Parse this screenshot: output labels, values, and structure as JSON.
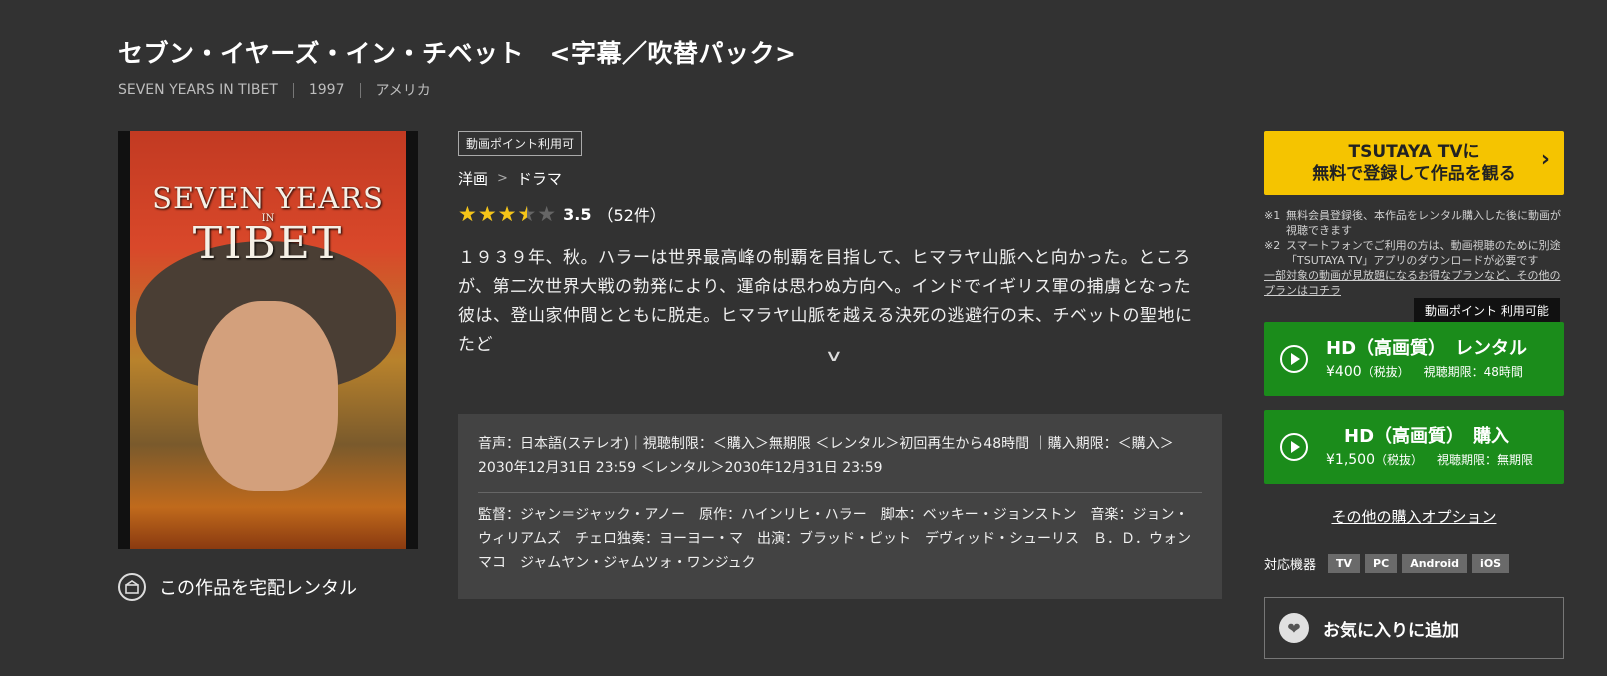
{
  "title": "セブン・イヤーズ・イン・チベット　<字幕／吹替パック>",
  "meta": {
    "original_title": "SEVEN YEARS IN TIBET",
    "year": "1997",
    "country": "アメリカ"
  },
  "poster": {
    "line1": "SEVEN YEARS",
    "line2": "IN",
    "line3": "TIBET"
  },
  "home_rental_label": "この作品を宅配レンタル",
  "point_badge": "動画ポイント利用可",
  "breadcrumb": [
    "洋画",
    "ドラマ"
  ],
  "rating": {
    "value": 3.5,
    "score_text": "3.5",
    "count_text": "（52件）"
  },
  "synopsis": "１９３９年、秋。ハラーは世界最高峰の制覇を目指して、ヒマラヤ山脈へと向かった。ところが、第二次世界大戦の勃発により、運命は思わぬ方向へ。インドでイギリス軍の捕虜となった彼は、登山家仲間とともに脱走。ヒマラヤ山脈を越える決死の逃避行の末、チベットの聖地にたど",
  "info": {
    "audio_text": "音声：日本語(ステレオ)｜視聴制限：＜購入＞無期限 ＜レンタル＞初回再生から48時間 ｜購入期限：＜購入＞2030年12月31日 23:59 ＜レンタル＞2030年12月31日 23:59",
    "credits_text": "監督：ジャン＝ジャック・アノー　原作：ハインリヒ・ハラー　脚本：ベッキー・ジョンストン　音楽：ジョン・ウィリアムズ　チェロ独奏：ヨーヨー・マ　出演：ブラッド・ピット　デヴィッド・シューリス　Ｂ．Ｄ．ウォン　マコ　ジャムヤン・ジャムツォ・ワンジュク"
  },
  "cta": {
    "line1": "TSUTAYA TVに",
    "line2": "無料で登録して作品を観る"
  },
  "notes": [
    {
      "key": "※1",
      "text": "無料会員登録後、本作品をレンタル購入した後に動画が視聴できます"
    },
    {
      "key": "※2",
      "text": "スマートフォンでご利用の方は、動画視聴のために別途「TSUTAYA TV」アプリのダウンロードが必要です"
    }
  ],
  "plan_link": "一部対象の動画が見放題になるお得なプランなど、その他のプランはコチラ",
  "tooltip": "動画ポイント 利用可能",
  "rental": {
    "title": "HD（高画質）　レンタル",
    "price": "¥400",
    "tax": "（税抜）",
    "limit": "視聴期限：48時間"
  },
  "purchase": {
    "title": "HD（高画質）　購入",
    "price": "¥1,500",
    "tax": "（税抜）",
    "limit": "視聴期限：無期限"
  },
  "other_options": "その他の購入オプション",
  "devices": {
    "label": "対応機器",
    "items": [
      "TV",
      "PC",
      "Android",
      "iOS"
    ]
  },
  "favorite_label": "お気に入りに追加",
  "colors": {
    "background": "#323232",
    "cta": "#f5c400",
    "buy": "#1b8c1b",
    "star": "#f5c518"
  }
}
